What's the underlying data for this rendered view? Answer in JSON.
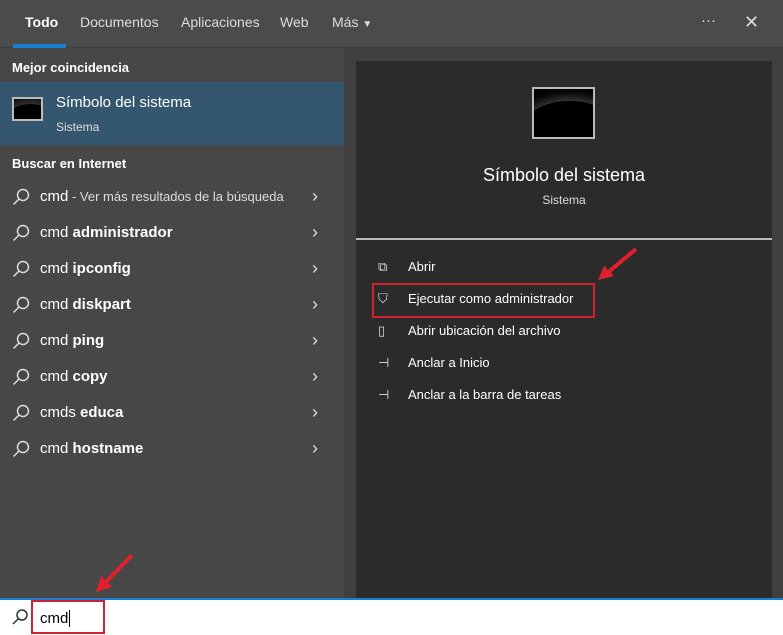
{
  "tabs": [
    {
      "label": "Todo"
    },
    {
      "label": "Documentos"
    },
    {
      "label": "Aplicaciones"
    },
    {
      "label": "Web"
    },
    {
      "label": "Más"
    }
  ],
  "header": {
    "more_icon": "···",
    "close_icon": "✕"
  },
  "best_match": {
    "heading": "Mejor coincidencia",
    "title": "Símbolo del sistema",
    "subtitle": "Sistema"
  },
  "internet": {
    "heading": "Buscar en Internet",
    "items": [
      {
        "query": "cmd",
        "bold": "",
        "suffix": " - Ver más resultados de la búsqueda"
      },
      {
        "query": "cmd ",
        "bold": "administrador",
        "suffix": ""
      },
      {
        "query": "cmd ",
        "bold": "ipconfig",
        "suffix": ""
      },
      {
        "query": "cmd ",
        "bold": "diskpart",
        "suffix": ""
      },
      {
        "query": "cmd ",
        "bold": "ping",
        "suffix": ""
      },
      {
        "query": "cmd ",
        "bold": "copy",
        "suffix": ""
      },
      {
        "query": "cmds ",
        "bold": "educa",
        "suffix": ""
      },
      {
        "query": "cmd ",
        "bold": "hostname",
        "suffix": ""
      }
    ]
  },
  "preview": {
    "title": "Símbolo del sistema",
    "subtitle": "Sistema",
    "actions": [
      {
        "label": "Abrir",
        "icon": "open-icon"
      },
      {
        "label": "Ejecutar como administrador",
        "icon": "shield-icon"
      },
      {
        "label": "Abrir ubicación del archivo",
        "icon": "file-location-icon"
      },
      {
        "label": "Anclar a Inicio",
        "icon": "pin-icon"
      },
      {
        "label": "Anclar a la barra de tareas",
        "icon": "pin-icon"
      }
    ]
  },
  "search": {
    "value": "cmd"
  },
  "colors": {
    "accent": "#1a7fd4",
    "highlight": "#d0222e",
    "selected": "#34566f"
  }
}
